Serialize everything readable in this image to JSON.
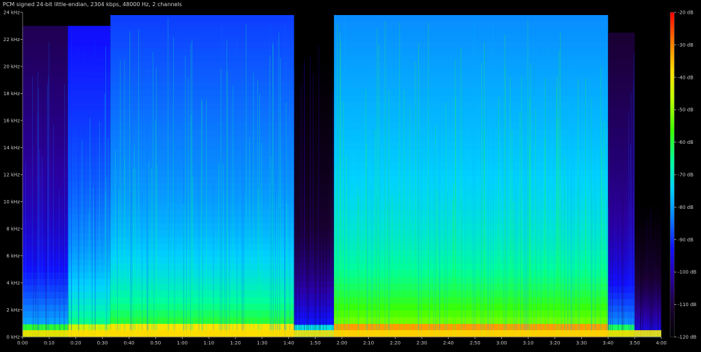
{
  "title": "PCM signed 24-bit little-endian, 2304 kbps, 48000 Hz, 2 channels",
  "chart_data": {
    "type": "heatmap",
    "subtype": "spectrogram",
    "x_ticks": [
      "0:00",
      "0:10",
      "0:20",
      "0:30",
      "0:40",
      "0:50",
      "1:00",
      "1:10",
      "1:20",
      "1:30",
      "1:40",
      "1:50",
      "2:00",
      "2:10",
      "2:20",
      "2:30",
      "2:40",
      "2:50",
      "3:00",
      "3:10",
      "3:20",
      "3:30",
      "3:40",
      "3:50",
      "4:00"
    ],
    "x_range_seconds": [
      0,
      240
    ],
    "y_ticks": [
      "0 kHz",
      "2 kHz",
      "4 kHz",
      "6 kHz",
      "8 kHz",
      "10 kHz",
      "12 kHz",
      "14 kHz",
      "16 kHz",
      "18 kHz",
      "20 kHz",
      "22 kHz",
      "24 kHz"
    ],
    "y_range_khz": [
      0,
      24
    ],
    "colorbar_ticks": [
      "-20 dB",
      "-30 dB",
      "-40 dB",
      "-50 dB",
      "-60 dB",
      "-70 dB",
      "-80 dB",
      "-90 dB",
      "-100 dB",
      "-110 dB",
      "-120 dB"
    ],
    "colorbar_range_db": [
      -20,
      -120
    ],
    "colormap": [
      "#000000",
      "#1a0033",
      "#2a00a0",
      "#1010ff",
      "#0a7cff",
      "#00d2ff",
      "#00ff9a",
      "#3cff00",
      "#b8ff00",
      "#ffe000",
      "#ff7a00",
      "#ff0000"
    ],
    "segments": [
      {
        "start_s": 0,
        "end_s": 17,
        "level_db": -95,
        "top_khz": 23.0
      },
      {
        "start_s": 17,
        "end_s": 33,
        "level_db": -80,
        "top_khz": 23.0
      },
      {
        "start_s": 33,
        "end_s": 102,
        "level_db": -75,
        "top_khz": 23.8
      },
      {
        "start_s": 102,
        "end_s": 117,
        "level_db": -108,
        "top_khz": 22.0
      },
      {
        "start_s": 117,
        "end_s": 220,
        "level_db": -68,
        "top_khz": 23.8
      },
      {
        "start_s": 220,
        "end_s": 230,
        "level_db": -98,
        "top_khz": 22.5
      },
      {
        "start_s": 230,
        "end_s": 240,
        "level_db": -115,
        "top_khz": 12.0
      }
    ]
  }
}
